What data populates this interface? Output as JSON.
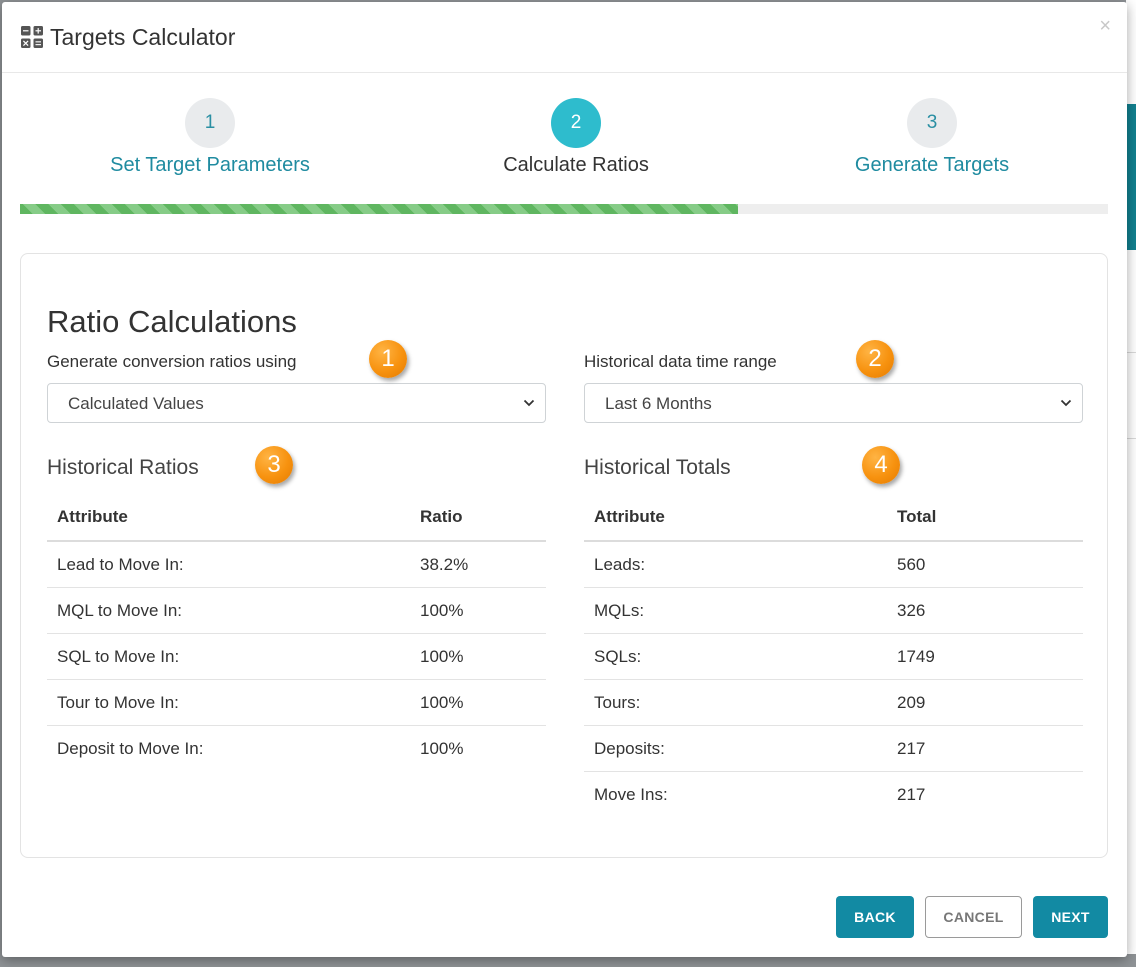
{
  "modal": {
    "title": "Targets Calculator",
    "close_label": "×"
  },
  "stepper": {
    "steps": [
      {
        "number": "1",
        "label": "Set Target Parameters"
      },
      {
        "number": "2",
        "label": "Calculate Ratios"
      },
      {
        "number": "3",
        "label": "Generate Targets"
      }
    ],
    "active_step": 2,
    "progress_fraction": 0.66
  },
  "ratio_calculations": {
    "title": "Ratio Calculations",
    "conversion_label": "Generate conversion ratios using",
    "conversion_value": "Calculated Values",
    "time_range_label": "Historical data time range",
    "time_range_value": "Last 6 Months"
  },
  "badges": [
    "1",
    "2",
    "3",
    "4"
  ],
  "historical_ratios": {
    "title": "Historical Ratios",
    "headers": [
      "Attribute",
      "Ratio"
    ],
    "rows": [
      [
        "Lead to Move In:",
        "38.2%"
      ],
      [
        "MQL to Move In:",
        "100%"
      ],
      [
        "SQL to Move In:",
        "100%"
      ],
      [
        "Tour to Move In:",
        "100%"
      ],
      [
        "Deposit to Move In:",
        "100%"
      ]
    ]
  },
  "historical_totals": {
    "title": "Historical Totals",
    "headers": [
      "Attribute",
      "Total"
    ],
    "rows": [
      [
        "Leads:",
        "560"
      ],
      [
        "MQLs:",
        "326"
      ],
      [
        "SQLs:",
        "1749"
      ],
      [
        "Tours:",
        "209"
      ],
      [
        "Deposits:",
        "217"
      ],
      [
        "Move Ins:",
        "217"
      ]
    ]
  },
  "buttons": {
    "back": "BACK",
    "cancel": "CANCEL",
    "next": "NEXT"
  },
  "colors": {
    "accent": "#128aa3",
    "active_step": "#2ebccd",
    "progress": "#5fb660",
    "badge": "#f7920f"
  }
}
